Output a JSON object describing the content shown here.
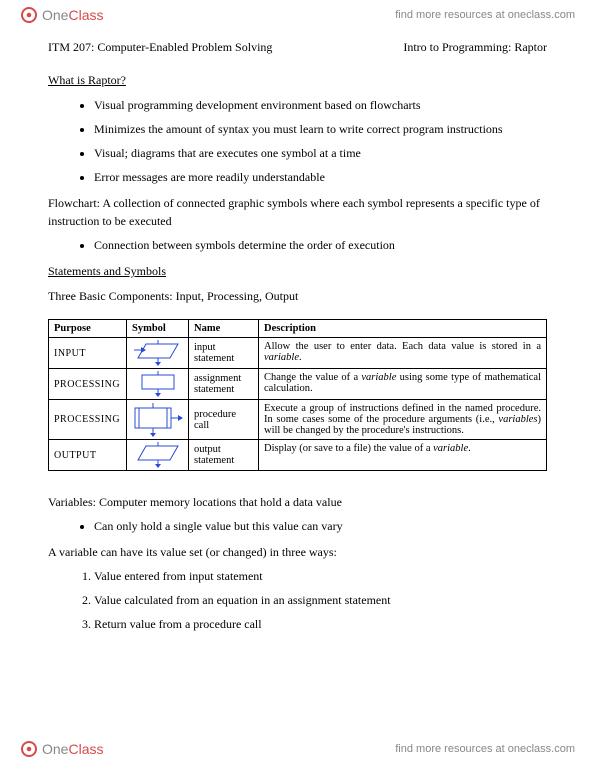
{
  "brand": {
    "one": "One",
    "class": "Class"
  },
  "find_more": "find more resources at oneclass.com",
  "course_left": "ITM 207: Computer-Enabled Problem Solving",
  "course_right": "Intro to Programming: Raptor",
  "h_raptor": "What is Raptor?",
  "raptor_bullets": [
    "Visual programming development environment based on flowcharts",
    "Minimizes the amount of syntax you must learn to write correct program instructions",
    "Visual; diagrams that are executes one symbol at a time",
    "Error messages are more readily understandable"
  ],
  "flowchart_def": "Flowchart: A collection of connected graphic symbols where each symbol represents a specific type of instruction to be executed",
  "flowchart_bullets": [
    "Connection between symbols determine the order of execution"
  ],
  "h_statements": "Statements and Symbols",
  "three_components": "Three Basic Components: Input, Processing, Output",
  "table": {
    "headers": {
      "purpose": "Purpose",
      "symbol": "Symbol",
      "name": "Name",
      "description": "Description"
    },
    "rows": [
      {
        "purpose": "INPUT",
        "name": "input statement",
        "desc_pre": "Allow the user to enter data. Each data value is stored in a ",
        "desc_em": "variable",
        "desc_post": "."
      },
      {
        "purpose": "PROCESSING",
        "name": "assignment statement",
        "desc_pre": "Change the value of a ",
        "desc_em": "variable",
        "desc_post": " using some type of mathematical calculation."
      },
      {
        "purpose": "PROCESSING",
        "name": "procedure call",
        "desc_pre": "Execute a group of instructions defined in the named procedure. In some cases some of the procedure arguments (i.e., ",
        "desc_em": "variables",
        "desc_post": ") will be changed by the procedure's instructions."
      },
      {
        "purpose": "OUTPUT",
        "name": "output statement",
        "desc_pre": "Display (or save to a file) the value of a ",
        "desc_em": "variable",
        "desc_post": "."
      }
    ]
  },
  "variables_def": "Variables: Computer memory locations that hold a data value",
  "variables_bullets": [
    "Can only hold a single value but this value can vary"
  ],
  "var_set_line": "A variable can have its value set (or changed) in three ways:",
  "var_set_numbers": [
    "Value entered from input statement",
    "Value calculated from an equation in an assignment statement",
    "Return value from a procedure call"
  ]
}
